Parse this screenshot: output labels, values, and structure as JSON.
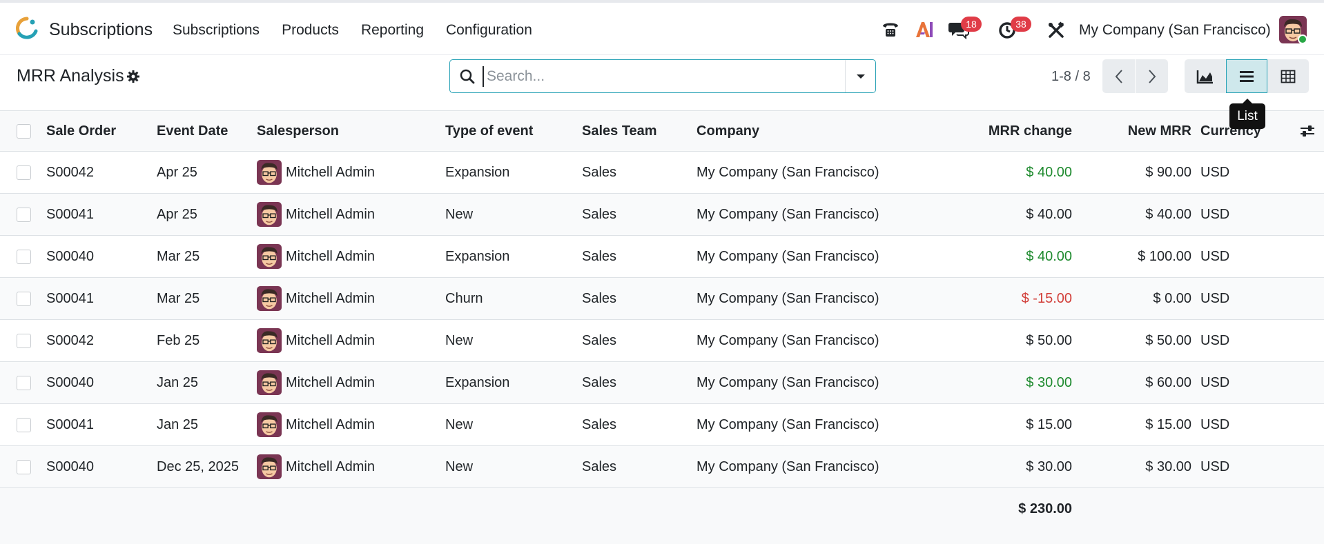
{
  "app": {
    "name": "Subscriptions"
  },
  "menu": [
    "Subscriptions",
    "Products",
    "Reporting",
    "Configuration"
  ],
  "systray": {
    "phone_icon": "phone-icon",
    "ai_icon": "ai-icon",
    "messages_badge": "18",
    "activities_badge": "38",
    "company": "My Company (San Francisco)"
  },
  "control": {
    "title": "MRR Analysis",
    "search_placeholder": "Search...",
    "pager": "1-8 / 8",
    "tooltip": "List"
  },
  "table": {
    "headers": {
      "sale_order": "Sale Order",
      "event_date": "Event Date",
      "salesperson": "Salesperson",
      "type": "Type of event",
      "team": "Sales Team",
      "company": "Company",
      "mrr_change": "MRR change",
      "new_mrr": "New MRR",
      "currency": "Currency"
    },
    "rows": [
      {
        "order": "S00042",
        "date": "Apr 25",
        "salesperson": "Mitchell Admin",
        "type": "Expansion",
        "team": "Sales",
        "company": "My Company (San Francisco)",
        "change": "$ 40.00",
        "change_sign": "pos",
        "new_mrr": "$ 90.00",
        "currency": "USD"
      },
      {
        "order": "S00041",
        "date": "Apr 25",
        "salesperson": "Mitchell Admin",
        "type": "New",
        "team": "Sales",
        "company": "My Company (San Francisco)",
        "change": "$ 40.00",
        "change_sign": "neutral",
        "new_mrr": "$ 40.00",
        "currency": "USD"
      },
      {
        "order": "S00040",
        "date": "Mar 25",
        "salesperson": "Mitchell Admin",
        "type": "Expansion",
        "team": "Sales",
        "company": "My Company (San Francisco)",
        "change": "$ 40.00",
        "change_sign": "pos",
        "new_mrr": "$ 100.00",
        "currency": "USD"
      },
      {
        "order": "S00041",
        "date": "Mar 25",
        "salesperson": "Mitchell Admin",
        "type": "Churn",
        "team": "Sales",
        "company": "My Company (San Francisco)",
        "change": "$ -15.00",
        "change_sign": "neg",
        "new_mrr": "$ 0.00",
        "currency": "USD"
      },
      {
        "order": "S00042",
        "date": "Feb 25",
        "salesperson": "Mitchell Admin",
        "type": "New",
        "team": "Sales",
        "company": "My Company (San Francisco)",
        "change": "$ 50.00",
        "change_sign": "neutral",
        "new_mrr": "$ 50.00",
        "currency": "USD"
      },
      {
        "order": "S00040",
        "date": "Jan 25",
        "salesperson": "Mitchell Admin",
        "type": "Expansion",
        "team": "Sales",
        "company": "My Company (San Francisco)",
        "change": "$ 30.00",
        "change_sign": "pos",
        "new_mrr": "$ 60.00",
        "currency": "USD"
      },
      {
        "order": "S00041",
        "date": "Jan 25",
        "salesperson": "Mitchell Admin",
        "type": "New",
        "team": "Sales",
        "company": "My Company (San Francisco)",
        "change": "$ 15.00",
        "change_sign": "neutral",
        "new_mrr": "$ 15.00",
        "currency": "USD"
      },
      {
        "order": "S00040",
        "date": "Dec 25, 2025",
        "salesperson": "Mitchell Admin",
        "type": "New",
        "team": "Sales",
        "company": "My Company (San Francisco)",
        "change": "$ 30.00",
        "change_sign": "neutral",
        "new_mrr": "$ 30.00",
        "currency": "USD"
      }
    ],
    "total_change": "$ 230.00"
  },
  "colors": {
    "accent": "#26a1b5",
    "positive": "#1e8a2e",
    "negative": "#d23f3a",
    "badge": "#e03c47"
  }
}
